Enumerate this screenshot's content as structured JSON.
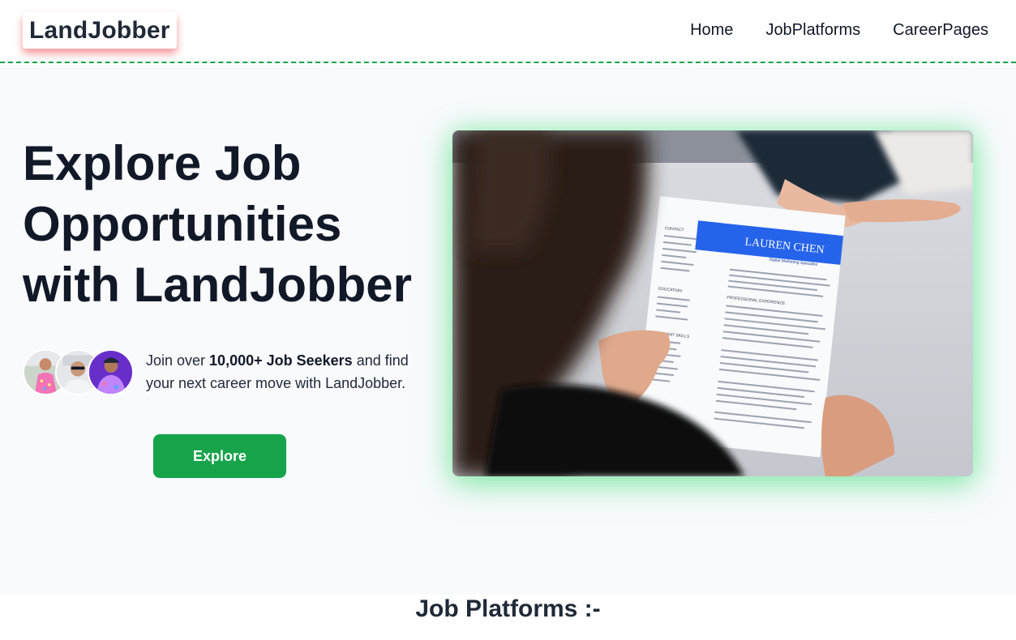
{
  "header": {
    "logo": "LandJobber",
    "nav": [
      "Home",
      "JobPlatforms",
      "CareerPages"
    ]
  },
  "hero": {
    "title": "Explore Job Opportunities with LandJobber",
    "join_prefix": "Join over ",
    "join_bold": "10,000+ Job Seekers",
    "join_suffix": " and find your next career move with LandJobber.",
    "button": "Explore",
    "avatars": [
      "avatar-1",
      "avatar-2",
      "avatar-3"
    ],
    "resume": {
      "name": "LAUREN CHEN",
      "role": "Digital Marketing Specialist",
      "headings": [
        "CONTACT",
        "EDUCATION",
        "RELEVANT SKILLS",
        "PROFESSIONAL EXPERIENCE"
      ]
    }
  },
  "sections": {
    "job_platforms_title": "Job Platforms :-"
  },
  "colors": {
    "accent": "#16a34a",
    "divider": "#16a34a",
    "logo_shadow": "#ef4444",
    "hero_bg": "#f8fafc",
    "text": "#111827"
  }
}
